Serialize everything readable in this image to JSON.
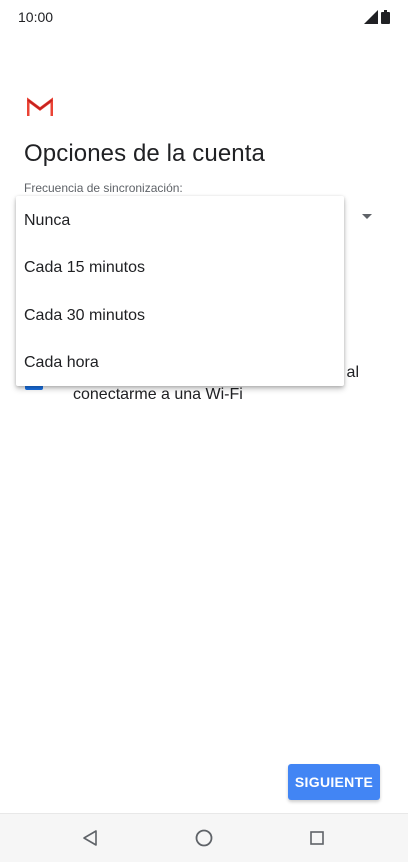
{
  "status_bar": {
    "time": "10:00",
    "icons": [
      "signal-icon",
      "battery-icon"
    ]
  },
  "app": {
    "logo": "gmail-logo-icon",
    "title": "Opciones de la cuenta"
  },
  "sync": {
    "label": "Frecuencia de sincronización:",
    "options": [
      "Nunca",
      "Cada 15 minutos",
      "Cada 30 minutos",
      "Cada hora"
    ]
  },
  "checkbox_row": {
    "line1": "al",
    "line2": "conectarme a una Wi-Fi",
    "checked": true
  },
  "actions": {
    "next_label": "SIGUIENTE"
  },
  "colors": {
    "accent": "#4285f4",
    "checkbox": "#1a73e8",
    "gmail_red": "#ea4335"
  },
  "nav_bar": {
    "buttons": [
      "back-icon",
      "home-icon",
      "recents-icon"
    ]
  }
}
